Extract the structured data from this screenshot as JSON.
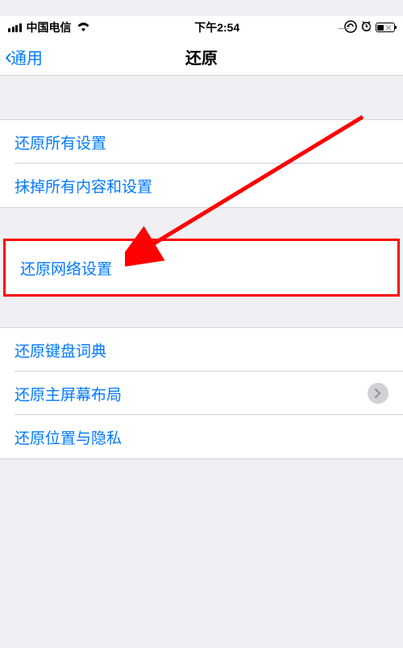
{
  "window": {
    "minimize": "—",
    "maximize": "□",
    "close": "×"
  },
  "statusBar": {
    "carrier": "中国电信",
    "time": "下午2:54",
    "orientationLock": "⊕",
    "alarm": "⏰"
  },
  "nav": {
    "back": "通用",
    "title": "还原"
  },
  "groups": {
    "g1": {
      "item1": "还原所有设置",
      "item2": "抹掉所有内容和设置"
    },
    "g2": {
      "item1": "还原网络设置"
    },
    "g3": {
      "item1": "还原键盘词典",
      "item2": "还原主屏幕布局",
      "item3": "还原位置与隐私"
    }
  },
  "annotation": {
    "highlightColor": "#ff0000"
  }
}
